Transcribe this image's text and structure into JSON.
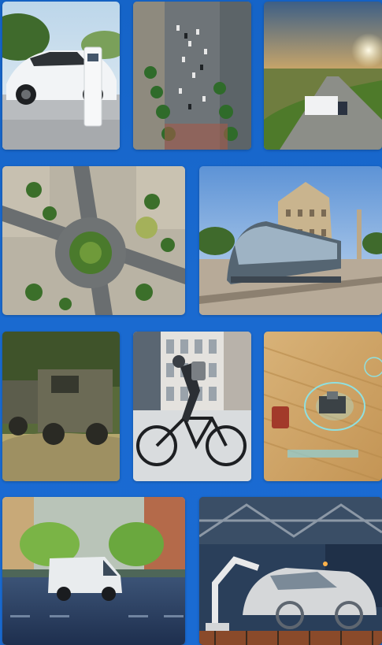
{
  "gallery": {
    "background_color": "#1a6ad0",
    "tiles": [
      {
        "subject": "electric-car-charging-icon"
      },
      {
        "subject": "city-traffic-aerial-icon"
      },
      {
        "subject": "highway-sunset-truck-icon"
      },
      {
        "subject": "roundabout-aerial-icon"
      },
      {
        "subject": "tram-city-square-icon"
      },
      {
        "subject": "military-trucks-icon"
      },
      {
        "subject": "cyclist-ebike-icon"
      },
      {
        "subject": "harvester-field-icon"
      },
      {
        "subject": "delivery-van-street-icon"
      },
      {
        "subject": "car-factory-robots-icon"
      }
    ]
  }
}
